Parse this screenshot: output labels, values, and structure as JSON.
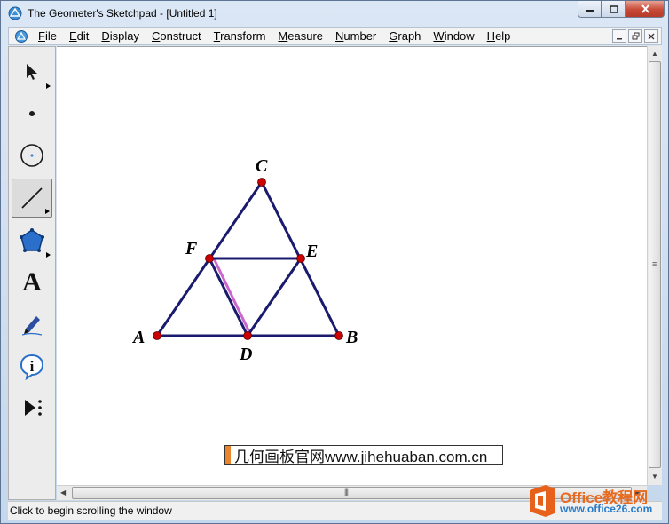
{
  "window": {
    "title": "The Geometer's Sketchpad - [Untitled 1]"
  },
  "menu": [
    {
      "pre": "",
      "u": "F",
      "post": "ile"
    },
    {
      "pre": "",
      "u": "E",
      "post": "dit"
    },
    {
      "pre": "",
      "u": "D",
      "post": "isplay"
    },
    {
      "pre": "",
      "u": "C",
      "post": "onstruct"
    },
    {
      "pre": "",
      "u": "T",
      "post": "ransform"
    },
    {
      "pre": "",
      "u": "M",
      "post": "easure"
    },
    {
      "pre": "",
      "u": "N",
      "post": "umber"
    },
    {
      "pre": "",
      "u": "G",
      "post": "raph"
    },
    {
      "pre": "",
      "u": "W",
      "post": "indow"
    },
    {
      "pre": "",
      "u": "H",
      "post": "elp"
    }
  ],
  "tools": {
    "arrow": "selection-arrow-icon",
    "point": "point-tool-icon",
    "compass": "compass-tool-icon",
    "straightedge": "straightedge-tool-icon",
    "polygon": "polygon-tool-icon",
    "text_glyph": "A",
    "marker": "marker-tool-icon",
    "info_glyph": "i",
    "custom": "custom-tool-icon"
  },
  "sketch": {
    "points": [
      {
        "label": "A"
      },
      {
        "label": "B"
      },
      {
        "label": "C"
      },
      {
        "label": "D"
      },
      {
        "label": "E"
      },
      {
        "label": "F"
      }
    ],
    "colors": {
      "segment": "#1a1a6e",
      "point": "#cc0000",
      "highlight": "#cc66cc"
    }
  },
  "watermark": {
    "text": "几何画板官网www.jihehuaban.com.cn"
  },
  "status": {
    "text": "Click to begin scrolling the window"
  },
  "office": {
    "name": "Office教程网",
    "url": "www.office26.com"
  }
}
